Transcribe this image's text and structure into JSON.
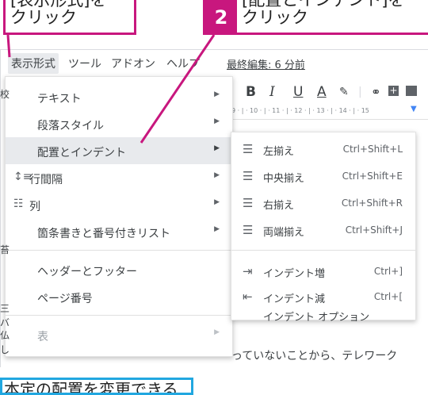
{
  "callouts": {
    "step1_line1": "[表示形式]を",
    "step1_line2": "クリック",
    "step2_number": "2",
    "step2_line1": "[配置とインデント]を",
    "step2_line2": "クリック"
  },
  "menubar": {
    "items": [
      "表示形式",
      "ツール",
      "アドオン",
      "ヘルプ"
    ],
    "last_edit": "最終編集: 6 分前"
  },
  "toolbar": {
    "bold": "B",
    "italic": "I",
    "underline": "U",
    "text_color": "A"
  },
  "ruler": "9 · | · 10 · | · 11 · | · 12 · | · 13 · | · 14 · | · 15",
  "format_menu": {
    "items": [
      {
        "label": "テキスト"
      },
      {
        "label": "段落スタイル"
      },
      {
        "label": "配置とインデント"
      },
      {
        "label": "行間隔"
      },
      {
        "label": "列"
      },
      {
        "label": "箇条書きと番号付きリスト"
      },
      {
        "label": "ヘッダーとフッター"
      },
      {
        "label": "ページ番号"
      },
      {
        "label": "表"
      }
    ]
  },
  "align_submenu": {
    "items": [
      {
        "label": "左揃え",
        "shortcut": "Ctrl+Shift+L"
      },
      {
        "label": "中央揃え",
        "shortcut": "Ctrl+Shift+E"
      },
      {
        "label": "右揃え",
        "shortcut": "Ctrl+Shift+R"
      },
      {
        "label": "両端揃え",
        "shortcut": "Ctrl+Shift+J"
      },
      {
        "label": "インデント増",
        "shortcut": "Ctrl+]"
      },
      {
        "label": "インデント減",
        "shortcut": "Ctrl+["
      },
      {
        "label": "インデント オプション",
        "shortcut": ""
      }
    ]
  },
  "doc_text": "っていないことから、テレワーク",
  "left_chars": [
    "校",
    "苔",
    "三",
    "バ",
    "仏",
    "し"
  ],
  "caption": "本定の配置を変更できる",
  "colors": {
    "accent": "#c8177e",
    "caption_border": "#21a7e0",
    "highlight": "#e8eaed"
  }
}
